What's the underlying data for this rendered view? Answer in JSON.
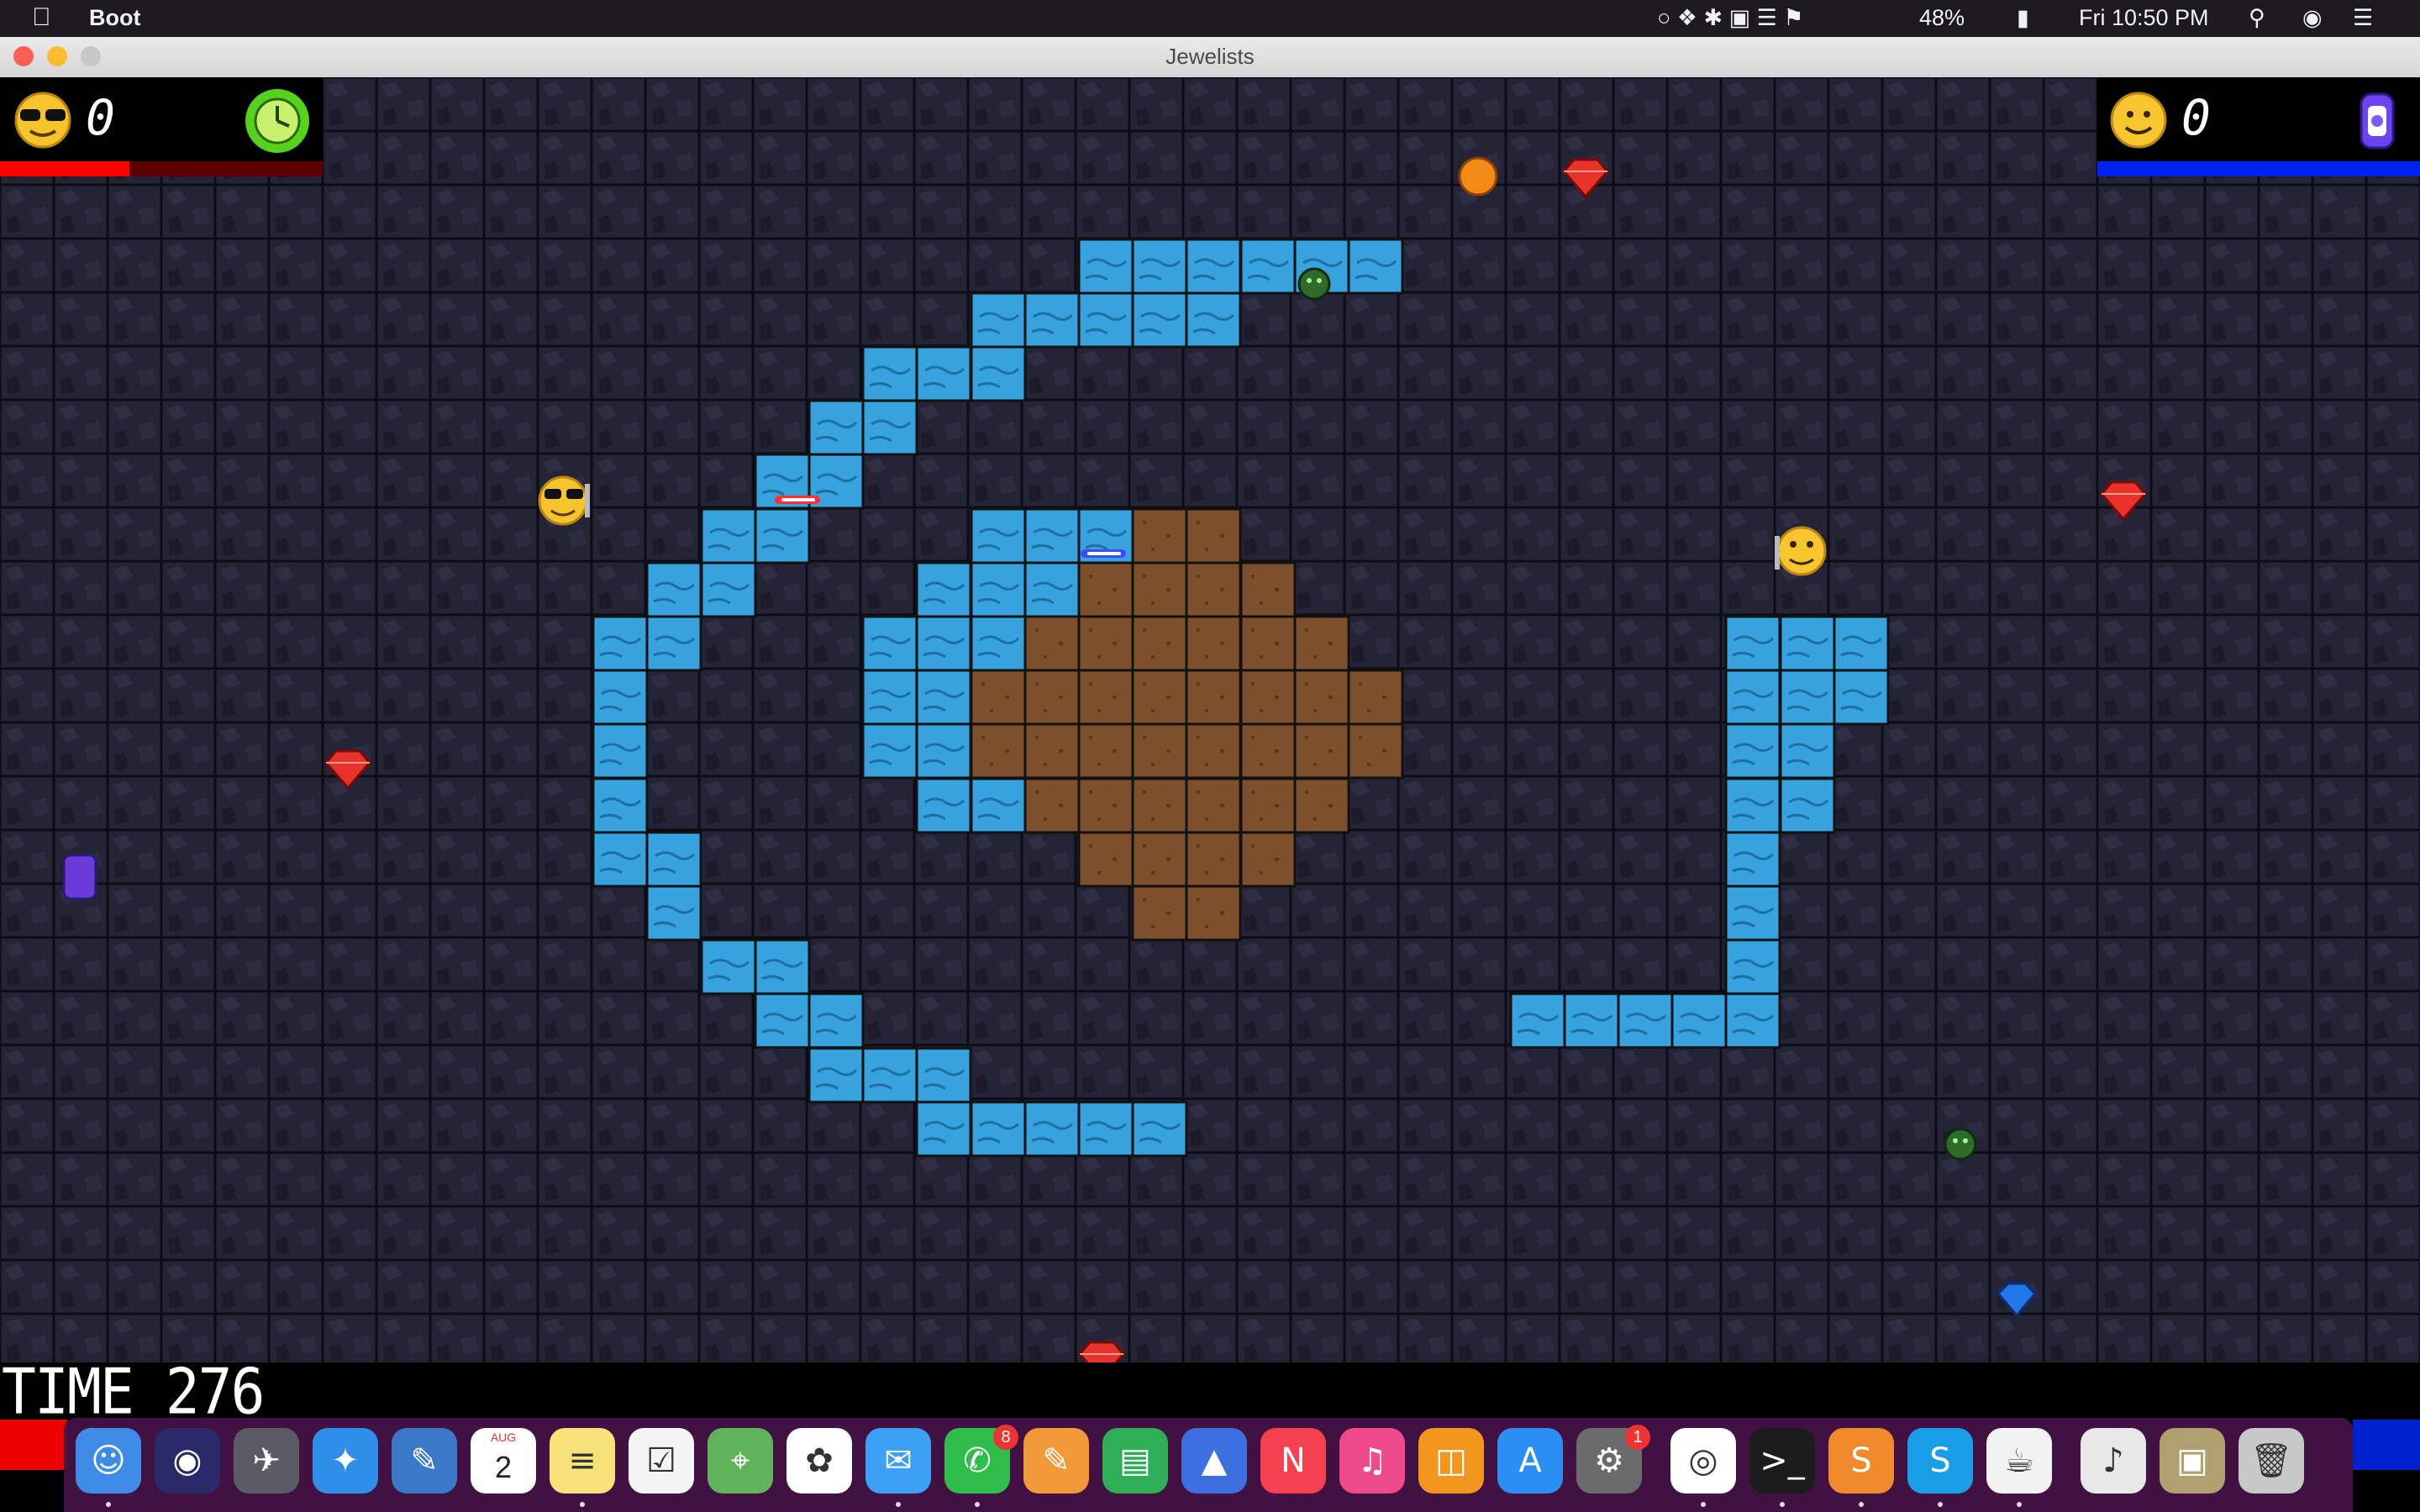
{
  "menubar": {
    "app_name": "Boot",
    "battery": "48%",
    "clock": "Fri 10:50 PM"
  },
  "window": {
    "title": "Jewelists"
  },
  "players": {
    "player1": {
      "score": "0",
      "avatar": "sunglasses-smiley-icon",
      "powerup": "green-clock-icon",
      "health_fraction": 0.4,
      "color": "#ff0000"
    },
    "player2": {
      "score": "0",
      "avatar": "smiley-icon",
      "powerup": "purple-lantern-icon",
      "health_fraction": 1.0,
      "color": "#0022ee"
    }
  },
  "time": {
    "label": "TIME 276"
  },
  "board_colors": {
    "floor": "#242333",
    "water": "#36a3de",
    "dirt": "#7d4f2c"
  },
  "dock": {
    "apps": [
      "Finder",
      "Siri",
      "Launchpad",
      "Safari",
      "Preview",
      "Calendar",
      "Notes",
      "Reminders",
      "Maps",
      "Photos",
      "Messages",
      "FaceTime",
      "Pages",
      "Numbers",
      "Keynote",
      "News",
      "iTunes",
      "Books",
      "App Store",
      "System Preferences",
      "Chrome",
      "Terminal",
      "Sublime Text",
      "Skype",
      "Java",
      "Music",
      "Preview Doc",
      "Trash"
    ],
    "calendar_month": "AUG",
    "calendar_day": "2",
    "facetime_badge": "8",
    "sysprefs_badge": "1"
  }
}
